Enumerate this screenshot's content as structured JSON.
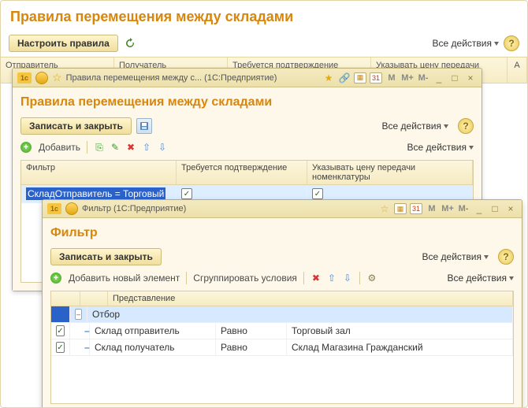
{
  "page": {
    "title": "Правила перемещения между складами",
    "configure_button": "Настроить правила",
    "all_actions": "Все действия",
    "columns": {
      "sender": "Отправитель",
      "receiver": "Получатель",
      "confirm": "Требуется подтверждение",
      "price": "Указывать цену передачи номенклатуры",
      "add": "A"
    }
  },
  "rules_window": {
    "titlebar": "Правила перемещения между с... (1С:Предприятие)",
    "heading": "Правила перемещения между складами",
    "save_close": "Записать и закрыть",
    "all_actions": "Все действия",
    "add": "Добавить",
    "columns": {
      "filter": "Фильтр",
      "confirm": "Требуется подтверждение",
      "price": "Указывать цену передачи номенклатуры"
    },
    "row": {
      "filter_text": "СкладОтправитель = Торговый",
      "confirm_checked": true,
      "price_checked": true
    }
  },
  "filter_window": {
    "titlebar": "Фильтр (1С:Предприятие)",
    "heading": "Фильтр",
    "save_close": "Записать и закрыть",
    "all_actions": "Все действия",
    "add_element": "Добавить новый элемент",
    "group_conditions": "Сгруппировать условия",
    "columns": {
      "representation": "Представление"
    },
    "tree": {
      "root": "Отбор",
      "rows": [
        {
          "checked": true,
          "field": "Склад отправитель",
          "op": "Равно",
          "value": "Торговый зал"
        },
        {
          "checked": true,
          "field": "Склад получатель",
          "op": "Равно",
          "value": "Склад Магазина Гражданский"
        }
      ]
    }
  },
  "icons": {
    "help": "?",
    "M": "M",
    "Mplus": "M+",
    "Mminus": "M-",
    "minimize": "_",
    "maximize": "□",
    "close": "×",
    "star": "☆",
    "star_fill": "★",
    "check": "✓",
    "plus": "+",
    "refresh": "⟳"
  }
}
